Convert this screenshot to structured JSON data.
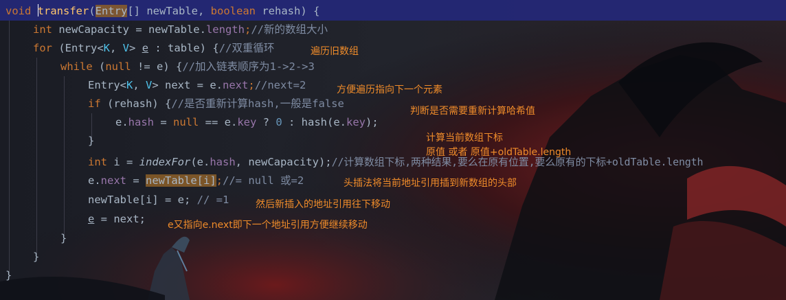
{
  "code": {
    "line1": {
      "kw_void": "void",
      "name": "transfer",
      "open": "(",
      "param_type": "Entry",
      "rest": "[] newTable, ",
      "kw_bool": "boolean",
      "rest2": " rehash) {"
    },
    "line2": {
      "kw": "int",
      "a": " newCapacity = newTable.",
      "field": "length",
      "b": ";",
      "comment": "//新的数组大小"
    },
    "line3": {
      "kw": "for",
      "a": " (Entry<",
      "k": "K",
      "sep": ", ",
      "v": "V",
      "b": "> ",
      "e": "e",
      "c": " : table) {",
      "comment": "//双重循环"
    },
    "line4": {
      "kw": "while",
      "a": " (",
      "kw_null": "null",
      "b": " != e) {",
      "comment": "//加入链表顺序为1->2->3"
    },
    "line5": {
      "a": "Entry<",
      "k": "K",
      "sep": ", ",
      "v": "V",
      "b": "> next = e.",
      "field": "next",
      "c": ";",
      "comment": "//next=2"
    },
    "line6": {
      "kw": "if",
      "a": " (rehash) {",
      "comment": "//是否重新计算hash,一般是false"
    },
    "line7": {
      "a": "e.",
      "field": "hash",
      "b": " = ",
      "kw_null": "null",
      "c": " == e.",
      "field2": "key",
      "d": " ? ",
      "num": "0",
      "e": " : hash(e.",
      "field3": "key",
      "f": ");"
    },
    "line8": {
      "a": "}"
    },
    "line9": {
      "kw": "int",
      "a": " i = ",
      "fn": "indexFor",
      "b": "(e.",
      "field": "hash",
      "c": ", newCapacity);",
      "comment": "//计算数组下标,两种结果,要么在原有位置,要么原有的下标+oldTable.length"
    },
    "line10": {
      "a": "e.",
      "field": "next",
      "b": " = ",
      "hl": "newTable[i]",
      "c": ";",
      "comment": "//= null 或=2"
    },
    "line11": {
      "a": "newTable[i] = e;",
      "comment": " // =1"
    },
    "line12": {
      "e": "e",
      "a": " = next;"
    },
    "line13": {
      "a": "}"
    },
    "line14": {
      "a": "}"
    },
    "line15": {
      "a": "}"
    }
  },
  "notes": {
    "n1": "遍历旧数组",
    "n2": "方便遍历指向下一个元素",
    "n3": "判断是否需要重新计算哈希值",
    "n4": "计算当前数组下标",
    "n5": "原值 或者 原值+oldTable.length",
    "n6": "头插法将当前地址引用插到新数组的头部",
    "n7": "然后新插入的地址引用往下移动",
    "n8": "e又指向e.next即下一个地址引用方便继续移动"
  }
}
